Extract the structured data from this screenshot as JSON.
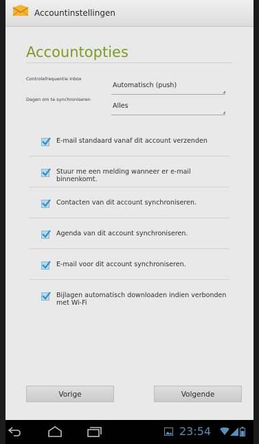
{
  "titlebar": {
    "title": "Accountinstellingen",
    "icon": "email-app-icon"
  },
  "heading": "Accountopties",
  "settings": [
    {
      "label": "Controlefrequentie inbox",
      "value": "Automatisch (push)"
    },
    {
      "label": "Dagen om te synchroniseren",
      "value": "Alles"
    }
  ],
  "checkboxes": [
    {
      "label": "E-mail standaard vanaf dit account verzenden",
      "checked": true
    },
    {
      "label": "Stuur me een melding wanneer er e-mail binnenkomt.",
      "checked": true
    },
    {
      "label": "Contacten van dit account synchroniseren.",
      "checked": true
    },
    {
      "label": "Agenda van dit account synchroniseren.",
      "checked": true
    },
    {
      "label": "E-mail voor dit account synchroniseren.",
      "checked": true
    },
    {
      "label": "Bijlagen automatisch downloaden indien verbonden met Wi-Fi",
      "checked": true
    }
  ],
  "buttons": {
    "previous": "Vorige",
    "next": "Volgende"
  },
  "navbar": {
    "time": "23:54",
    "icons": [
      "back-icon",
      "home-icon",
      "recent-apps-icon",
      "gallery-notification-icon",
      "wifi-icon",
      "signal-icon",
      "battery-icon"
    ]
  },
  "colors": {
    "accent": "#7f9a2c",
    "checkbox": "#b7d7ea",
    "clock": "#5c8fb6"
  }
}
